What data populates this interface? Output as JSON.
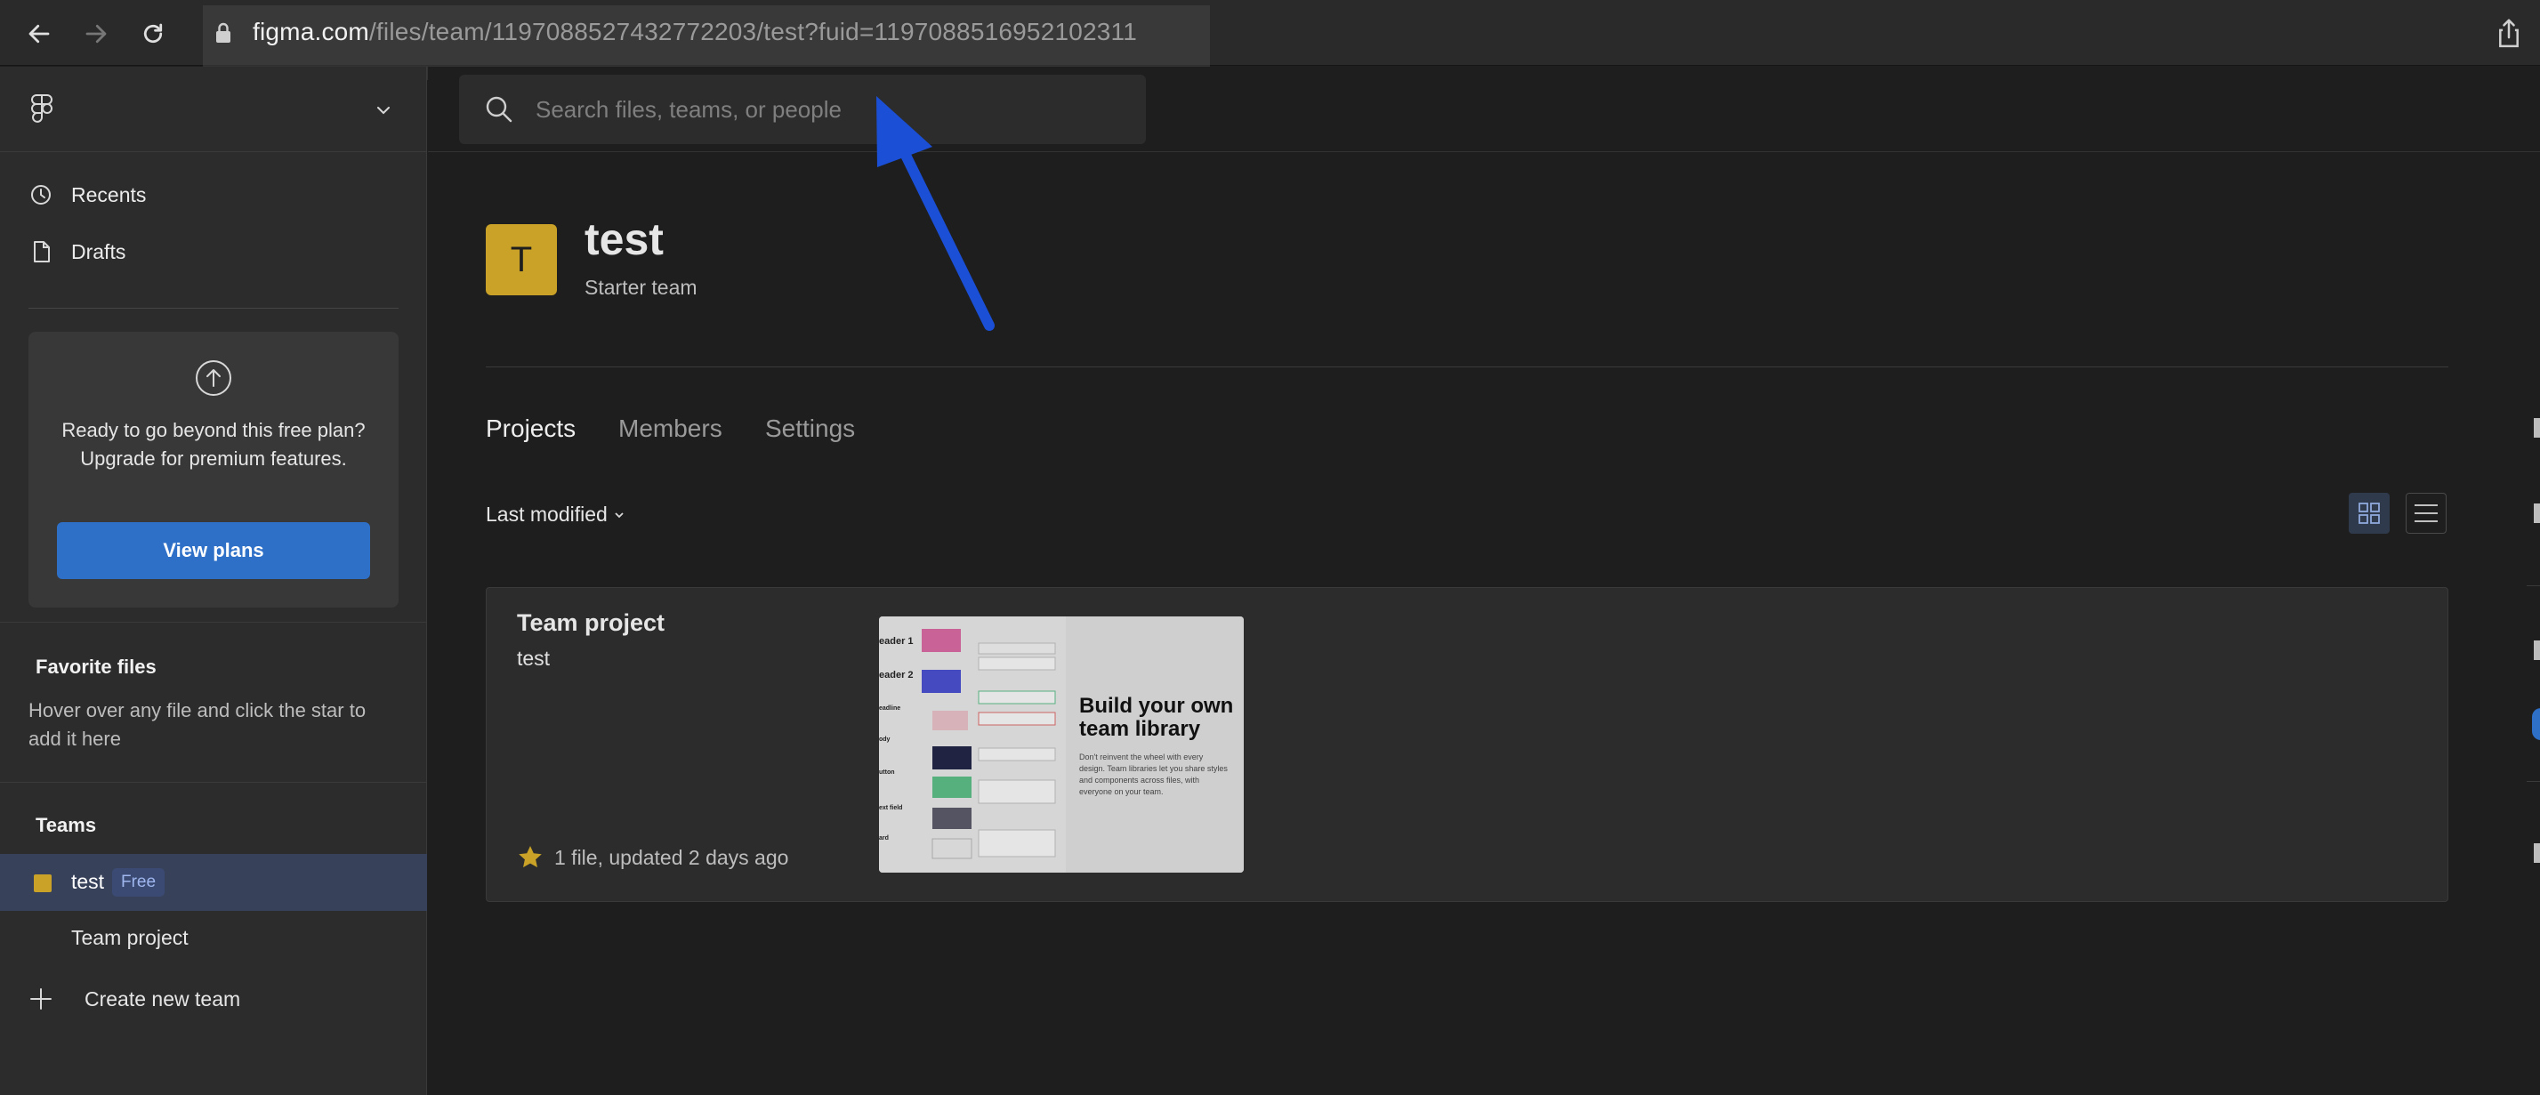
{
  "browser": {
    "url_host": "figma.com",
    "url_path": "/files/team/1197088527432772203/test?fuid=1197088516952102311"
  },
  "sidebar": {
    "nav": [
      {
        "label": "Recents",
        "icon": "clock-icon"
      },
      {
        "label": "Drafts",
        "icon": "file-icon"
      }
    ],
    "upgrade": {
      "text": "Ready to go beyond this free plan? Upgrade for premium features.",
      "button": "View plans"
    },
    "favorites": {
      "heading": "Favorite files",
      "hint": "Hover over any file and click the star to add it here"
    },
    "teams": {
      "heading": "Teams",
      "team_name": "test",
      "team_badge": "Free",
      "project": "Team project",
      "create": "Create new team"
    }
  },
  "search": {
    "placeholder": "Search files, teams, or people"
  },
  "team": {
    "avatar_letter": "T",
    "name": "test",
    "plan": "Starter team"
  },
  "tabs": [
    "Projects",
    "Members",
    "Settings"
  ],
  "active_tab": "Projects",
  "sort": {
    "label": "Last modified"
  },
  "project_card": {
    "title": "Team project",
    "team": "test",
    "meta": "1 file, updated 2 days ago",
    "thumbnail": {
      "heading": "Build your own team library",
      "body": "Don't reinvent the wheel with every design. Team libraries let you share styles and components across files, with everyone on your team.",
      "labels": [
        "eader 1",
        "eader 2",
        "eadline",
        "ody",
        "utton",
        "ext field",
        "ard"
      ]
    }
  },
  "colors": {
    "accent": "#2e6fc7",
    "team": "#c9a227",
    "arrow": "#1a4fd6",
    "selected_row": "#38415a"
  }
}
